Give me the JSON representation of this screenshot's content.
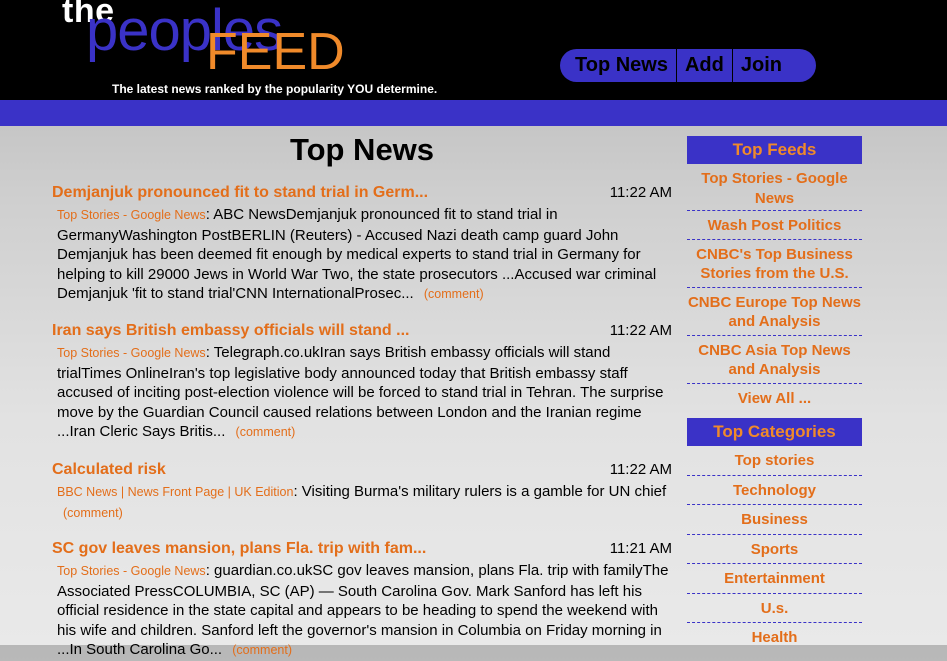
{
  "header": {
    "logo_the": "the",
    "logo_peoples": "peoples",
    "logo_feed": "FEED",
    "tagline": "The latest news ranked by the popularity YOU determine.",
    "nav": [
      "Top News",
      "Add",
      "Join"
    ]
  },
  "main": {
    "title": "Top News",
    "stories": [
      {
        "title": "Demjanjuk pronounced fit to stand trial in Germ...",
        "time": "11:22 AM",
        "source": "Top Stories - Google News",
        "text": "ABC NewsDemjanjuk pronounced fit to stand trial in GermanyWashington PostBERLIN (Reuters) - Accused Nazi death camp guard John Demjanjuk has been deemed fit enough by medical experts to stand trial in Germany for helping to kill 29000 Jews in World War Two, the state prosecutors ...Accused war criminal Demjanjuk 'fit to stand trial'CNN InternationalProsec...",
        "comment": "(comment)"
      },
      {
        "title": "Iran says British embassy officials will stand ...",
        "time": "11:22 AM",
        "source": "Top Stories - Google News",
        "text": "Telegraph.co.ukIran says British embassy officials will stand trialTimes OnlineIran's top legislative body announced today that British embassy staff accused of inciting post-election violence will be forced to stand trial in Tehran. The surprise move by the Guardian Council caused relations between London and the Iranian regime ...Iran Cleric Says Britis...",
        "comment": "(comment)"
      },
      {
        "title": "Calculated risk",
        "time": "11:22 AM",
        "source": "BBC News | News Front Page | UK Edition",
        "text": "Visiting Burma's military rulers is a gamble for UN chief",
        "comment": "(comment)"
      },
      {
        "title": "SC gov leaves mansion, plans Fla. trip with fam...",
        "time": "11:21 AM",
        "source": "Top Stories - Google News",
        "text": "guardian.co.ukSC gov leaves mansion, plans Fla. trip with familyThe Associated PressCOLUMBIA, SC (AP) — South Carolina Gov. Mark Sanford has left his official residence in the state capital and appears to be heading to spend the weekend with his wife and children. Sanford left the governor's mansion in Columbia on Friday morning in ...In South Carolina Go...",
        "comment": "(comment)"
      }
    ]
  },
  "sidebar": {
    "feeds_heading": "Top Feeds",
    "feeds": [
      "Top Stories - Google News",
      "Wash Post Politics",
      "CNBC's Top Business Stories from the U.S.",
      "CNBC Europe Top News and Analysis",
      "CNBC Asia Top News and Analysis",
      "View All ..."
    ],
    "categories_heading": "Top Categories",
    "categories": [
      "Top stories",
      "Technology",
      "Business",
      "Sports",
      "Entertainment",
      "U.s.",
      "Health"
    ]
  },
  "colors": {
    "brand_blue": "#3a32c7",
    "accent_orange": "#e36e1a",
    "header_black": "#000000"
  }
}
